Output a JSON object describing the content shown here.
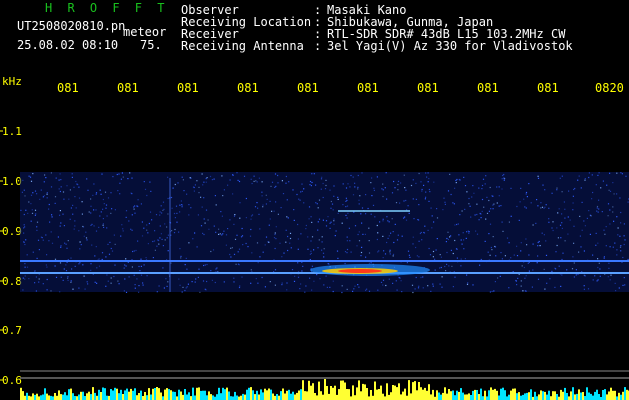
{
  "header": {
    "brand": "H R O F F T",
    "filename": "UT2508020810.pn",
    "kind": "meteor",
    "datetime": "25.08.02 08:10",
    "speed": "75.",
    "fields": [
      {
        "label": "Observer",
        "value": "Masaki Kano"
      },
      {
        "label": "Receiving Location",
        "value": "Shibukawa, Gunma, Japan"
      },
      {
        "label": "Receiver",
        "value": "RTL-SDR SDR# 43dB L15 103.2MHz CW"
      },
      {
        "label": "Receiving Antenna",
        "value": "3el Yagi(V) Az 330 for Vladivostok"
      }
    ]
  },
  "axis": {
    "unit": "kHz",
    "time_ticks": [
      "081",
      "081",
      "081",
      "081",
      "081",
      "081",
      "081",
      "081",
      "081",
      "0820"
    ],
    "freq_ticks": [
      "1.1",
      "1.0",
      "0.9",
      "0.8",
      "0.7",
      "0.6"
    ]
  },
  "colors": {
    "background": "#000000",
    "brand": "#19c01e",
    "axis_text": "#ffff00",
    "noise": "#1a3cff",
    "echo": "#ff3a1a"
  }
}
